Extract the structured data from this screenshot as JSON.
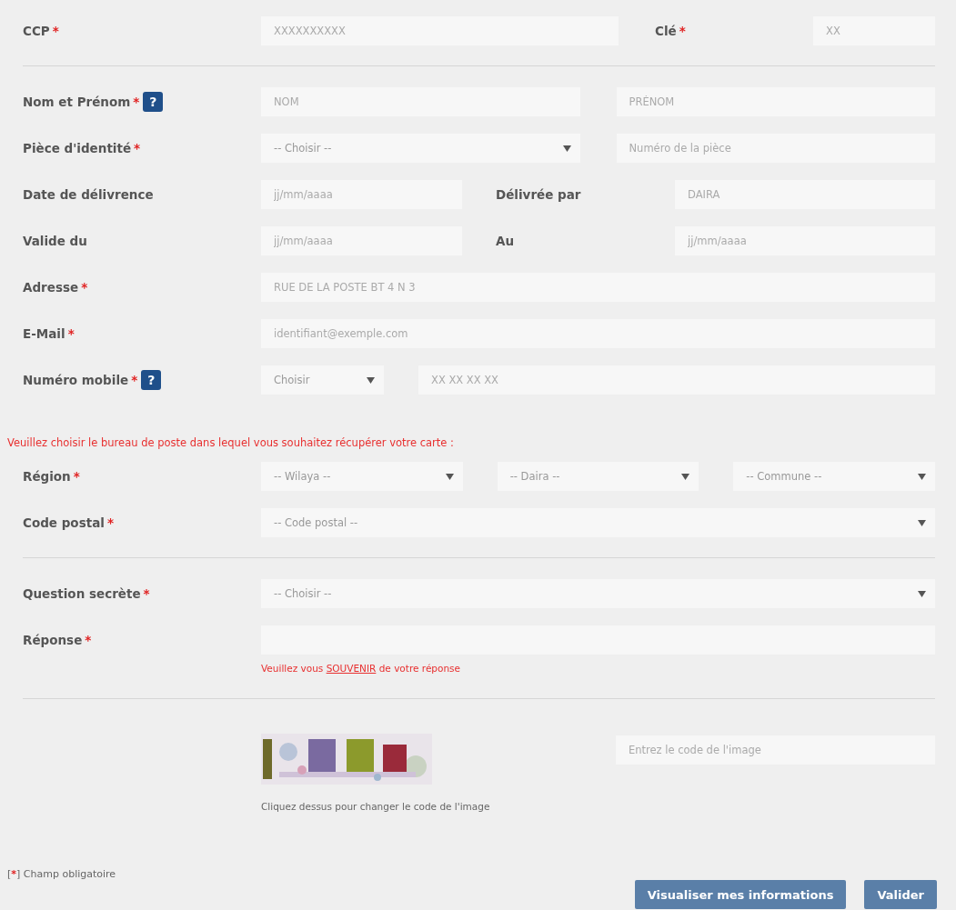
{
  "sections": [
    {
      "divider": false,
      "rows": [
        {
          "label": {
            "text": "CCP",
            "mark": "*"
          },
          "controls": [
            {
              "kind": "input",
              "placeholder": "XXXXXXXXXX"
            },
            {
              "kind": "label",
              "text": "Clé",
              "mark": "*"
            },
            {
              "kind": "input",
              "placeholder": "XX"
            }
          ]
        }
      ]
    },
    {
      "divider": true,
      "rows": [
        {
          "label": {
            "text": "Nom et Prénom",
            "mark": "*",
            "help": "?"
          },
          "controls": [
            {
              "kind": "input",
              "placeholder": "NOM"
            },
            {
              "kind": "input",
              "placeholder": "PRÉNOM"
            }
          ]
        },
        {
          "label": {
            "text": "Pièce d'identité",
            "mark": "*"
          },
          "controls": [
            {
              "kind": "select",
              "text": "-- Choisir --"
            },
            {
              "kind": "input",
              "placeholder": "Numéro de la pièce"
            }
          ]
        },
        {
          "label": {
            "text": "Date de délivrence"
          },
          "controls": [
            {
              "kind": "input",
              "placeholder": "jj/mm/aaaa"
            },
            {
              "kind": "label",
              "text": "Délivrée par"
            },
            {
              "kind": "input",
              "placeholder": "DAIRA"
            }
          ]
        },
        {
          "label": {
            "text": "Valide du"
          },
          "controls": [
            {
              "kind": "input",
              "placeholder": "jj/mm/aaaa"
            },
            {
              "kind": "label",
              "text": "Au"
            },
            {
              "kind": "input",
              "placeholder": "jj/mm/aaaa"
            }
          ]
        },
        {
          "label": {
            "text": "Adresse",
            "mark": "*"
          },
          "controls": [
            {
              "kind": "input",
              "placeholder": "RUE DE LA POSTE BT 4 N 3"
            }
          ]
        },
        {
          "label": {
            "text": "E-Mail",
            "mark": "*"
          },
          "controls": [
            {
              "kind": "input",
              "placeholder": "identifiant@exemple.com"
            }
          ]
        },
        {
          "label": {
            "text": "Numéro mobile",
            "mark": "*",
            "help": "?"
          },
          "controls": [
            {
              "kind": "select",
              "text": "Choisir"
            },
            {
              "kind": "input",
              "placeholder": "XX XX XX XX"
            }
          ]
        }
      ]
    },
    {
      "divider": false,
      "notice": "Veuillez choisir le bureau de poste dans lequel vous souhaitez récupérer votre carte :",
      "rows": [
        {
          "label": {
            "text": "Région",
            "mark": "*"
          },
          "controls": [
            {
              "kind": "select",
              "text": "-- Wilaya --"
            },
            {
              "kind": "select",
              "text": "-- Daira --"
            },
            {
              "kind": "select",
              "text": "-- Commune --"
            }
          ]
        },
        {
          "label": {
            "text": "Code postal",
            "mark": "*"
          },
          "controls": [
            {
              "kind": "select",
              "text": "-- Code postal --"
            }
          ]
        }
      ]
    },
    {
      "divider": true,
      "rows": [
        {
          "label": {
            "text": "Question secrète",
            "mark": "*"
          },
          "controls": [
            {
              "kind": "select",
              "text": "-- Choisir --"
            }
          ]
        },
        {
          "label": {
            "text": "Réponse",
            "mark": "*"
          },
          "controls": [
            {
              "kind": "input"
            }
          ],
          "hint": {
            "before": "Veuillez vous",
            "link": "SOUVENIR",
            "after": "de votre réponse"
          }
        }
      ]
    }
  ],
  "captcha": {
    "divider": true,
    "caption": "Cliquez dessus pour changer le code de l'image",
    "input": {
      "placeholder": "Entrez le code de l'image"
    }
  },
  "legend": {
    "open": "[",
    "mark": "*",
    "text": "] Champ obligatoire"
  },
  "buttons": [
    "Visualiser mes informations",
    "Valider"
  ]
}
